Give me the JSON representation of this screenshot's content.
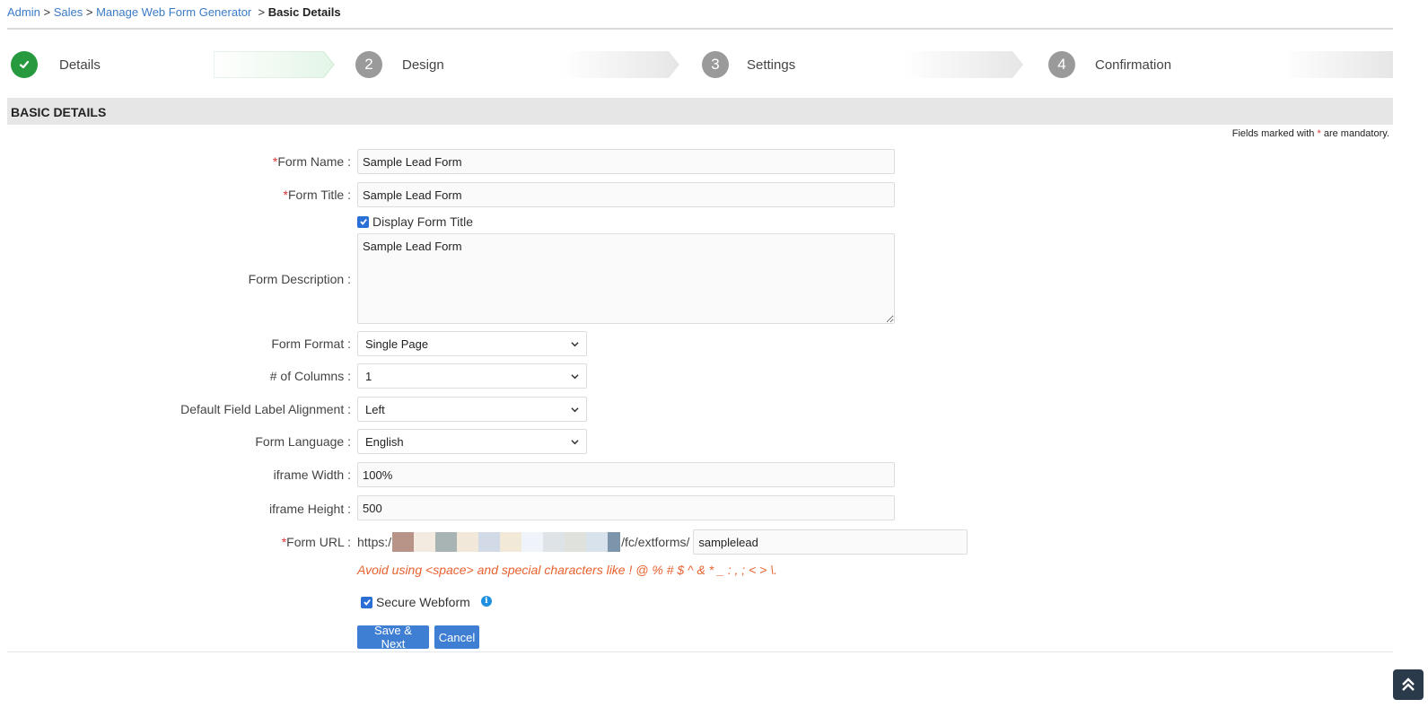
{
  "breadcrumb": {
    "items": [
      "Admin",
      "Sales",
      "Manage Web Form Generator"
    ],
    "separator": ">",
    "current": "Basic Details"
  },
  "wizard": {
    "steps": [
      {
        "number": "",
        "label": "Details",
        "state": "done"
      },
      {
        "number": "2",
        "label": "Design",
        "state": "pending"
      },
      {
        "number": "3",
        "label": "Settings",
        "state": "pending"
      },
      {
        "number": "4",
        "label": "Confirmation",
        "state": "pending"
      }
    ]
  },
  "section": {
    "title": "BASIC DETAILS"
  },
  "mandatory_note": {
    "prefix": "Fields marked with",
    "star": "*",
    "suffix": "are mandatory."
  },
  "form": {
    "star": "*",
    "form_name_label": "Form Name :",
    "form_name_value": "Sample Lead Form",
    "form_title_label": "Form Title :",
    "form_title_value": "Sample Lead Form",
    "display_title_label": "Display Form Title",
    "display_title_checked": true,
    "description_label": "Form Description :",
    "description_value": "Sample Lead Form",
    "format_label": "Form Format :",
    "format_value": "Single Page",
    "columns_label": "# of Columns :",
    "columns_value": "1",
    "alignment_label": "Default Field Label Alignment :",
    "alignment_value": "Left",
    "language_label": "Form Language :",
    "language_value": "English",
    "iframe_width_label": "iframe Width :",
    "iframe_width_value": "100%",
    "iframe_height_label": "iframe Height :",
    "iframe_height_value": "500",
    "url_label": "Form URL :",
    "url_prefix": "https:/",
    "url_path": "/fc/extforms/",
    "url_slug_value": "samplelead",
    "url_warning": "Avoid using <space> and special characters like ! @ % # $ ^ & * _ : , ; < > \\.",
    "secure_label": "Secure Webform",
    "secure_checked": true,
    "info_icon": "info-icon"
  },
  "buttons": {
    "save_next": "Save & Next",
    "cancel": "Cancel"
  },
  "colors": {
    "accent": "#3e7fd4",
    "done": "#27993f",
    "warning": "#e8622f",
    "required": "#dd3333"
  }
}
